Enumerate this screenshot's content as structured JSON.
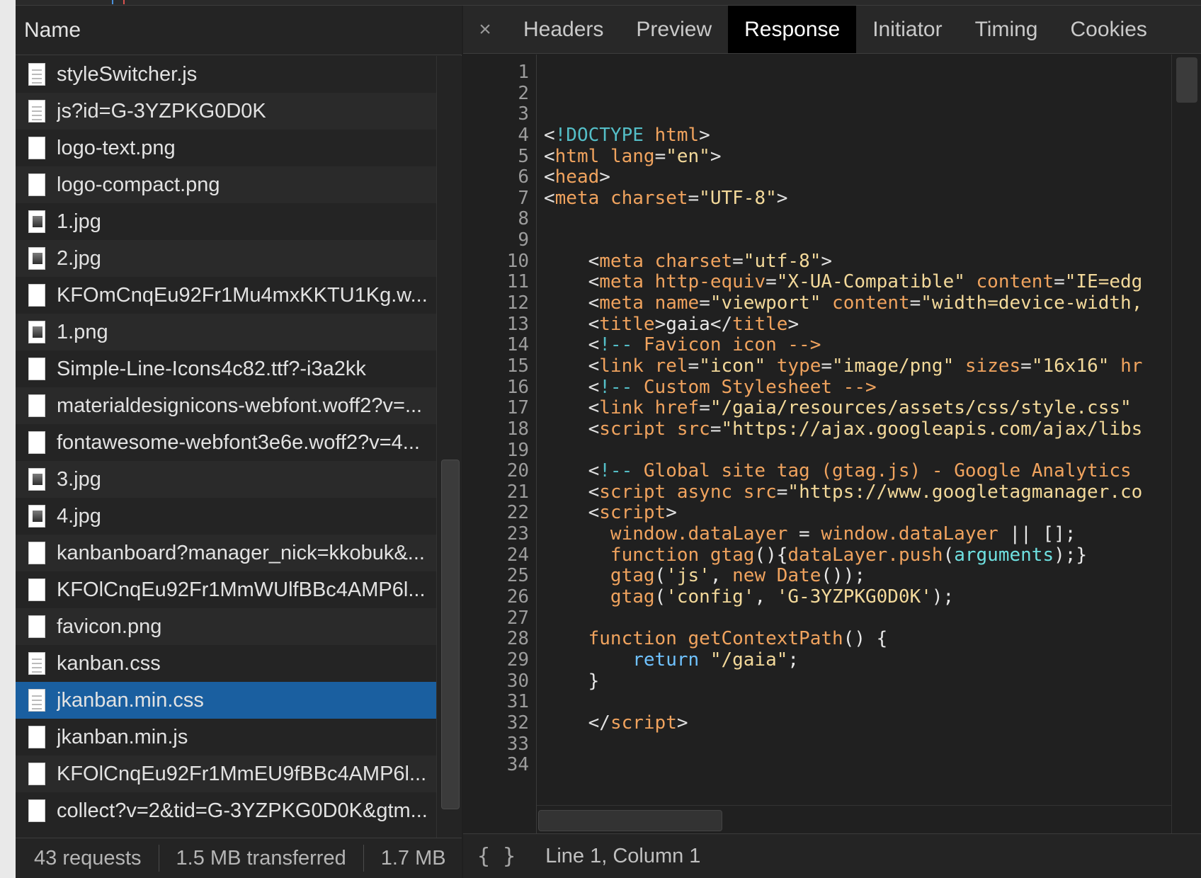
{
  "left_panel": {
    "column_header": "Name",
    "files": [
      {
        "name": "styleSwitcher.js",
        "icon": "document-icon",
        "type": "doc"
      },
      {
        "name": "js?id=G-3YZPKG0D0K",
        "icon": "document-icon",
        "type": "doc"
      },
      {
        "name": "logo-text.png",
        "icon": "blank-file-icon",
        "type": "blank"
      },
      {
        "name": "logo-compact.png",
        "icon": "blank-file-icon",
        "type": "blank"
      },
      {
        "name": "1.jpg",
        "icon": "image-thumbnail-icon",
        "type": "img"
      },
      {
        "name": "2.jpg",
        "icon": "image-thumbnail-icon",
        "type": "img"
      },
      {
        "name": "KFOmCnqEu92Fr1Mu4mxKKTU1Kg.w...",
        "icon": "blank-file-icon",
        "type": "blank"
      },
      {
        "name": "1.png",
        "icon": "image-thumbnail-icon",
        "type": "img"
      },
      {
        "name": "Simple-Line-Icons4c82.ttf?-i3a2kk",
        "icon": "blank-file-icon",
        "type": "blank"
      },
      {
        "name": "materialdesignicons-webfont.woff2?v=...",
        "icon": "blank-file-icon",
        "type": "blank"
      },
      {
        "name": "fontawesome-webfont3e6e.woff2?v=4...",
        "icon": "blank-file-icon",
        "type": "blank"
      },
      {
        "name": "3.jpg",
        "icon": "image-thumbnail-icon",
        "type": "img"
      },
      {
        "name": "4.jpg",
        "icon": "image-thumbnail-icon",
        "type": "img"
      },
      {
        "name": "kanbanboard?manager_nick=kkobuk&...",
        "icon": "blank-file-icon",
        "type": "blank"
      },
      {
        "name": "KFOlCnqEu92Fr1MmWUlfBBc4AMP6l...",
        "icon": "blank-file-icon",
        "type": "blank"
      },
      {
        "name": "favicon.png",
        "icon": "blank-file-icon",
        "type": "blank"
      },
      {
        "name": "kanban.css",
        "icon": "document-icon",
        "type": "doc"
      },
      {
        "name": "jkanban.min.css",
        "icon": "document-icon",
        "type": "doc",
        "selected": true
      },
      {
        "name": "jkanban.min.js",
        "icon": "blank-file-icon",
        "type": "blank"
      },
      {
        "name": "KFOlCnqEu92Fr1MmEU9fBBc4AMP6l...",
        "icon": "blank-file-icon",
        "type": "blank"
      },
      {
        "name": "collect?v=2&tid=G-3YZPKG0D0K&gtm...",
        "icon": "blank-file-icon",
        "type": "blank"
      }
    ],
    "status": {
      "requests": "43 requests",
      "transferred": "1.5 MB transferred",
      "resources": "1.7 MB"
    }
  },
  "right_panel": {
    "close_label": "×",
    "tabs": [
      {
        "label": "Headers",
        "active": false
      },
      {
        "label": "Preview",
        "active": false
      },
      {
        "label": "Response",
        "active": true
      },
      {
        "label": "Initiator",
        "active": false
      },
      {
        "label": "Timing",
        "active": false
      },
      {
        "label": "Cookies",
        "active": false
      }
    ],
    "line_numbers": [
      "1",
      "2",
      "3",
      "4",
      "5",
      "6",
      "7",
      "8",
      "9",
      "10",
      "11",
      "12",
      "13",
      "14",
      "15",
      "16",
      "17",
      "18",
      "19",
      "20",
      "21",
      "22",
      "23",
      "24",
      "25",
      "26",
      "27",
      "28",
      "29",
      "30",
      "31",
      "32",
      "33",
      "34"
    ],
    "code_lines": [
      [],
      [],
      [],
      [
        [
          "punct",
          "<"
        ],
        [
          "doctype",
          "!DOCTYPE"
        ],
        [
          "plain",
          " "
        ],
        [
          "tag",
          "html"
        ],
        [
          "punct",
          ">"
        ]
      ],
      [
        [
          "punct",
          "<"
        ],
        [
          "tag",
          "html"
        ],
        [
          "plain",
          " "
        ],
        [
          "attr",
          "lang"
        ],
        [
          "punct",
          "="
        ],
        [
          "val",
          "\"en\""
        ],
        [
          "punct",
          ">"
        ]
      ],
      [
        [
          "punct",
          "<"
        ],
        [
          "tag",
          "head"
        ],
        [
          "punct",
          ">"
        ]
      ],
      [
        [
          "punct",
          "<"
        ],
        [
          "tag",
          "meta"
        ],
        [
          "plain",
          " "
        ],
        [
          "attr",
          "charset"
        ],
        [
          "punct",
          "="
        ],
        [
          "val",
          "\"UTF-8\""
        ],
        [
          "punct",
          ">"
        ]
      ],
      [],
      [],
      [
        [
          "plain",
          "    "
        ],
        [
          "punct",
          "<"
        ],
        [
          "tag",
          "meta"
        ],
        [
          "plain",
          " "
        ],
        [
          "attr",
          "charset"
        ],
        [
          "punct",
          "="
        ],
        [
          "val",
          "\"utf-8\""
        ],
        [
          "punct",
          ">"
        ]
      ],
      [
        [
          "plain",
          "    "
        ],
        [
          "punct",
          "<"
        ],
        [
          "tag",
          "meta"
        ],
        [
          "plain",
          " "
        ],
        [
          "attr",
          "http-equiv"
        ],
        [
          "punct",
          "="
        ],
        [
          "val",
          "\"X-UA-Compatible\""
        ],
        [
          "plain",
          " "
        ],
        [
          "attr",
          "content"
        ],
        [
          "punct",
          "="
        ],
        [
          "val",
          "\"IE=edg"
        ]
      ],
      [
        [
          "plain",
          "    "
        ],
        [
          "punct",
          "<"
        ],
        [
          "tag",
          "meta"
        ],
        [
          "plain",
          " "
        ],
        [
          "attr",
          "name"
        ],
        [
          "punct",
          "="
        ],
        [
          "val",
          "\"viewport\""
        ],
        [
          "plain",
          " "
        ],
        [
          "attr",
          "content"
        ],
        [
          "punct",
          "="
        ],
        [
          "val",
          "\"width=device-width,"
        ]
      ],
      [
        [
          "plain",
          "    "
        ],
        [
          "punct",
          "<"
        ],
        [
          "tag",
          "title"
        ],
        [
          "punct",
          ">"
        ],
        [
          "plain",
          "gaia"
        ],
        [
          "punct",
          "</"
        ],
        [
          "tag",
          "title"
        ],
        [
          "punct",
          ">"
        ]
      ],
      [
        [
          "plain",
          "    "
        ],
        [
          "punct",
          "<"
        ],
        [
          "comment-dash",
          "!--"
        ],
        [
          "comment",
          " Favicon icon "
        ],
        [
          "comment",
          "-->"
        ]
      ],
      [
        [
          "plain",
          "    "
        ],
        [
          "punct",
          "<"
        ],
        [
          "tag",
          "link"
        ],
        [
          "plain",
          " "
        ],
        [
          "attr",
          "rel"
        ],
        [
          "punct",
          "="
        ],
        [
          "val",
          "\"icon\""
        ],
        [
          "plain",
          " "
        ],
        [
          "attr",
          "type"
        ],
        [
          "punct",
          "="
        ],
        [
          "val",
          "\"image/png\""
        ],
        [
          "plain",
          " "
        ],
        [
          "attr",
          "sizes"
        ],
        [
          "punct",
          "="
        ],
        [
          "val",
          "\"16x16\""
        ],
        [
          "plain",
          " "
        ],
        [
          "attr",
          "hr"
        ]
      ],
      [
        [
          "plain",
          "    "
        ],
        [
          "punct",
          "<"
        ],
        [
          "comment-dash",
          "!--"
        ],
        [
          "comment",
          " Custom Stylesheet "
        ],
        [
          "comment",
          "-->"
        ]
      ],
      [
        [
          "plain",
          "    "
        ],
        [
          "punct",
          "<"
        ],
        [
          "tag",
          "link"
        ],
        [
          "plain",
          " "
        ],
        [
          "attr",
          "href"
        ],
        [
          "punct",
          "="
        ],
        [
          "val",
          "\"/gaia/resources/assets/css/style.css\""
        ]
      ],
      [
        [
          "plain",
          "    "
        ],
        [
          "punct",
          "<"
        ],
        [
          "tag",
          "script"
        ],
        [
          "plain",
          " "
        ],
        [
          "attr",
          "src"
        ],
        [
          "punct",
          "="
        ],
        [
          "val",
          "\"https://ajax.googleapis.com/ajax/libs"
        ]
      ],
      [],
      [
        [
          "plain",
          "    "
        ],
        [
          "punct",
          "<"
        ],
        [
          "comment-dash",
          "!--"
        ],
        [
          "comment",
          " Global site tag (gtag.js) - Google Analytics "
        ]
      ],
      [
        [
          "plain",
          "    "
        ],
        [
          "punct",
          "<"
        ],
        [
          "tag",
          "script"
        ],
        [
          "plain",
          " "
        ],
        [
          "attr",
          "async"
        ],
        [
          "plain",
          " "
        ],
        [
          "attr",
          "src"
        ],
        [
          "punct",
          "="
        ],
        [
          "val",
          "\"https://www.googletagmanager.co"
        ]
      ],
      [
        [
          "plain",
          "    "
        ],
        [
          "punct",
          "<"
        ],
        [
          "tag",
          "script"
        ],
        [
          "punct",
          ">"
        ]
      ],
      [
        [
          "plain",
          "      "
        ],
        [
          "fn",
          "window.dataLayer"
        ],
        [
          "plain",
          " = "
        ],
        [
          "fn",
          "window.dataLayer"
        ],
        [
          "plain",
          " || [];"
        ]
      ],
      [
        [
          "plain",
          "      "
        ],
        [
          "fn",
          "function"
        ],
        [
          "plain",
          " "
        ],
        [
          "fn",
          "gtag"
        ],
        [
          "plain",
          "(){"
        ],
        [
          "fn",
          "dataLayer.push"
        ],
        [
          "plain",
          "("
        ],
        [
          "arg",
          "arguments"
        ],
        [
          "plain",
          ");}"
        ]
      ],
      [
        [
          "plain",
          "      "
        ],
        [
          "fn",
          "gtag"
        ],
        [
          "plain",
          "("
        ],
        [
          "str",
          "'js'"
        ],
        [
          "plain",
          ", "
        ],
        [
          "fn",
          "new"
        ],
        [
          "plain",
          " "
        ],
        [
          "fn",
          "Date"
        ],
        [
          "plain",
          "());"
        ]
      ],
      [
        [
          "plain",
          "      "
        ],
        [
          "fn",
          "gtag"
        ],
        [
          "plain",
          "("
        ],
        [
          "str",
          "'config'"
        ],
        [
          "plain",
          ", "
        ],
        [
          "str",
          "'G-3YZPKG0D0K'"
        ],
        [
          "plain",
          ");"
        ]
      ],
      [],
      [
        [
          "plain",
          "    "
        ],
        [
          "fn",
          "function"
        ],
        [
          "plain",
          " "
        ],
        [
          "fn",
          "getContextPath"
        ],
        [
          "plain",
          "() {"
        ]
      ],
      [
        [
          "plain",
          "        "
        ],
        [
          "kw",
          "return"
        ],
        [
          "plain",
          " "
        ],
        [
          "str",
          "\"/gaia\""
        ],
        [
          "plain",
          ";"
        ]
      ],
      [
        [
          "plain",
          "    }"
        ]
      ],
      [],
      [
        [
          "plain",
          "    "
        ],
        [
          "punct",
          "</"
        ],
        [
          "tag",
          "script"
        ],
        [
          "punct",
          ">"
        ]
      ],
      [],
      []
    ],
    "footer": {
      "pretty_print": "{ }",
      "cursor_position": "Line 1, Column 1"
    }
  },
  "colors": {
    "selected_row": "#1a5fa0",
    "active_tab_bg": "#000000",
    "tag": "#f0a35e",
    "string": "#f3d99a",
    "keyword": "#6fc2ff",
    "doctype": "#54bec7"
  }
}
